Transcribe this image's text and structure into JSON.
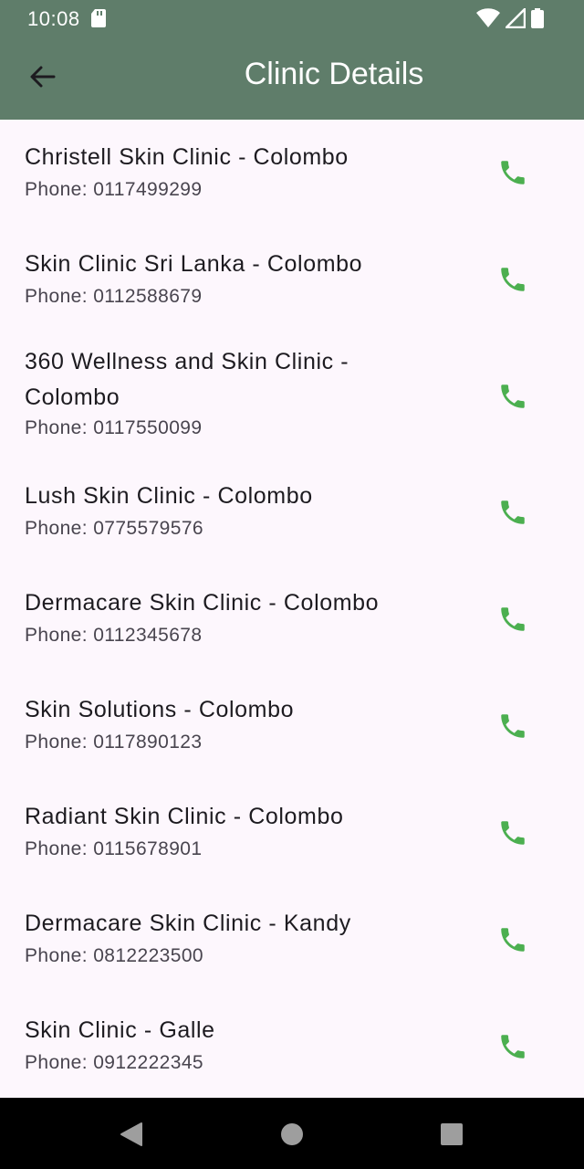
{
  "status_bar": {
    "time": "10:08",
    "icons": [
      "sd-card-icon",
      "wifi-icon",
      "signal-icon",
      "battery-icon"
    ]
  },
  "toolbar": {
    "title": "Clinic Details",
    "back_icon": "arrow-back-icon",
    "color": "#5f7d6a"
  },
  "clinics": [
    {
      "name": "Christell Skin Clinic - Colombo",
      "phone": "Phone: 0117499299"
    },
    {
      "name": "Skin Clinic Sri Lanka - Colombo",
      "phone": "Phone: 0112588679"
    },
    {
      "name": "360 Wellness and Skin Clinic - Colombo",
      "phone": "Phone: 0117550099"
    },
    {
      "name": "Lush Skin Clinic - Colombo",
      "phone": "Phone: 0775579576"
    },
    {
      "name": "Dermacare Skin Clinic - Colombo",
      "phone": "Phone: 0112345678"
    },
    {
      "name": "Skin Solutions - Colombo",
      "phone": "Phone: 0117890123"
    },
    {
      "name": "Radiant Skin Clinic - Colombo",
      "phone": "Phone: 0115678901"
    },
    {
      "name": "Dermacare Skin Clinic - Kandy",
      "phone": "Phone: 0812223500"
    },
    {
      "name": "Skin Clinic - Galle",
      "phone": "Phone: 0912222345"
    }
  ],
  "call_icon": "phone-icon",
  "call_icon_color": "#4caf50",
  "nav_bar": {
    "icons": [
      "back-triangle-icon",
      "home-circle-icon",
      "recents-square-icon"
    ]
  }
}
